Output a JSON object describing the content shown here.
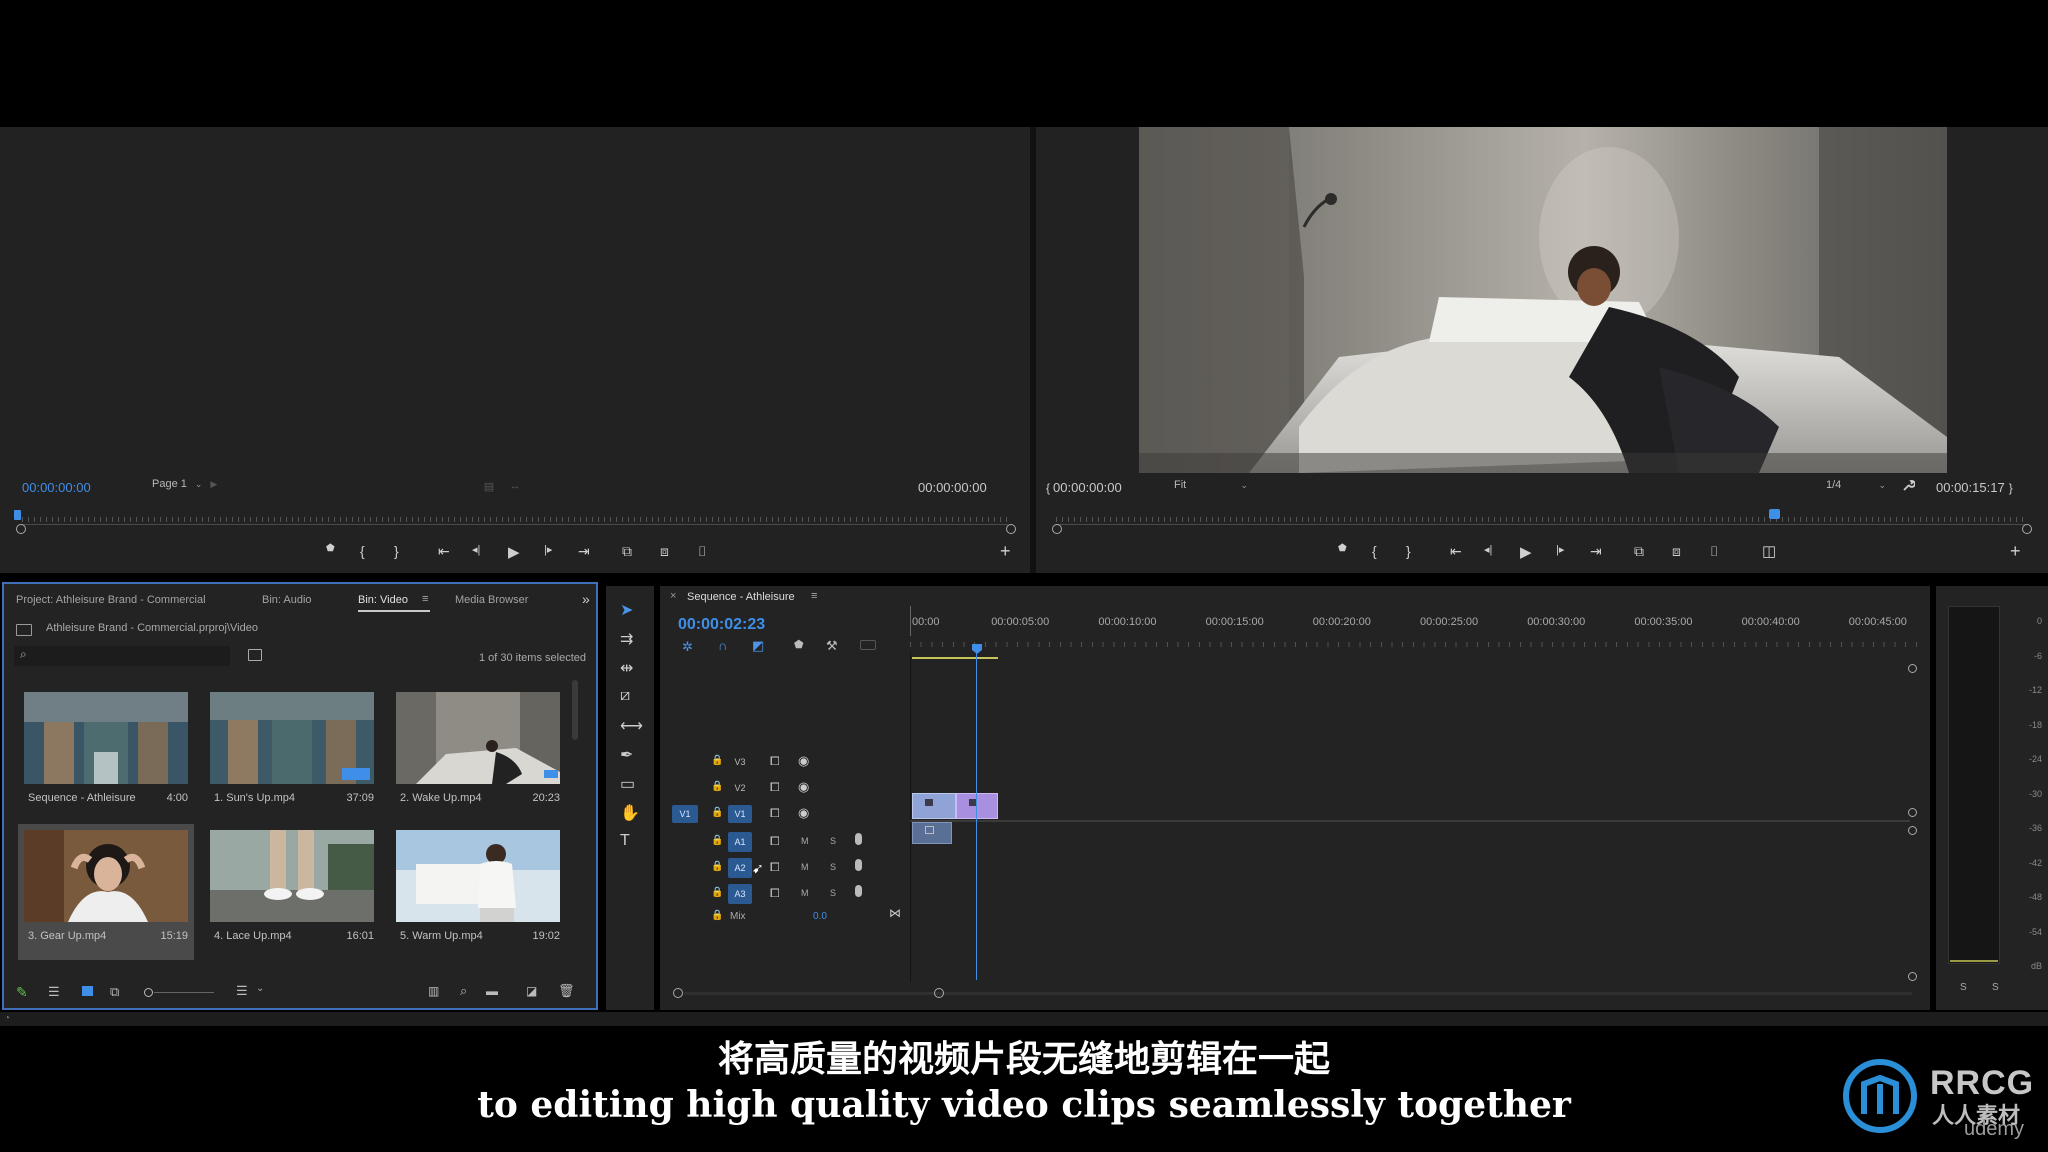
{
  "source_monitor": {
    "timecode_in": "00:00:00:00",
    "page_select": "Page 1",
    "timecode_out": "00:00:00:00"
  },
  "program_monitor": {
    "timecode_in": "00:00:00:00",
    "zoom": "Fit",
    "resolution": "1/4",
    "duration": "00:00:15:17",
    "playhead_fraction": 0.74
  },
  "project_panel": {
    "tabs": [
      "Project: Athleisure Brand - Commercial",
      "Bin: Audio",
      "Bin: Video",
      "Media Browser"
    ],
    "active_tab": "Bin: Video",
    "path": "Athleisure Brand - Commercial.prproj\\Video",
    "selection_status": "1 of 30 items selected",
    "items": [
      {
        "name": "Sequence - Athleisure",
        "duration": "4:00"
      },
      {
        "name": "1. Sun's Up.mp4",
        "duration": "37:09"
      },
      {
        "name": "2. Wake Up.mp4",
        "duration": "20:23"
      },
      {
        "name": "3. Gear Up.mp4",
        "duration": "15:19"
      },
      {
        "name": "4. Lace Up.mp4",
        "duration": "16:01"
      },
      {
        "name": "5. Warm Up.mp4",
        "duration": "19:02"
      }
    ]
  },
  "timeline": {
    "tab": "Sequence - Athleisure",
    "timecode": "00:00:02:23",
    "ruler": [
      "00:00",
      "00:00:05:00",
      "00:00:10:00",
      "00:00:15:00",
      "00:00:20:00",
      "00:00:25:00",
      "00:00:30:00",
      "00:00:35:00",
      "00:00:40:00",
      "00:00:45:00"
    ],
    "video_tracks": [
      "V3",
      "V2",
      "V1"
    ],
    "audio_tracks": [
      "A1",
      "A2",
      "A3"
    ],
    "source_v": "V1",
    "mix_label": "Mix",
    "mix_value": "0.0",
    "mute_label": "M",
    "solo_label": "S"
  },
  "meter": {
    "scale": [
      "0",
      "-6",
      "-12",
      "-18",
      "-24",
      "-30",
      "-36",
      "-42",
      "-48",
      "-54",
      "dB"
    ],
    "solo_labels": [
      "S",
      "S"
    ]
  },
  "subtitles": {
    "zh": "将高质量的视频片段无缝地剪辑在一起",
    "en": "to editing high quality video clips seamlessly together"
  },
  "watermark": {
    "brand": "RRCG",
    "cn": "人人素材",
    "sub": "udemy"
  },
  "colors": {
    "accent_blue": "#3f8ee8",
    "video_clip_a": "#8fa3d6",
    "video_clip_b": "#a98fe0",
    "audio_clip": "#5a6f96",
    "target_track": "#2b5a93"
  }
}
